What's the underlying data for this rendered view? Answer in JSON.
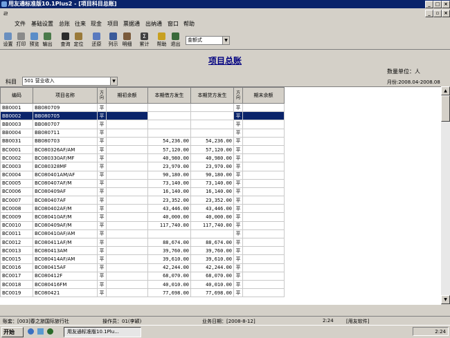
{
  "window": {
    "title": "用友通标准版10.1Plus2 - [项目科目总账]"
  },
  "menu": [
    "文件",
    "基础设置",
    "总账",
    "往来",
    "现金",
    "项目",
    "票据通",
    "出纳通",
    "窗口",
    "帮助"
  ],
  "toolbar": {
    "buttons": [
      {
        "label": "设置",
        "icon": "settings-icon",
        "color": "#6a8fbf"
      },
      {
        "label": "打印",
        "icon": "print-icon",
        "color": "#8a8a8a"
      },
      {
        "label": "预览",
        "icon": "preview-icon",
        "color": "#5b8dc8"
      },
      {
        "label": "输出",
        "icon": "export-icon",
        "color": "#4a7a4a"
      },
      {
        "label": "查询",
        "icon": "query-icon",
        "color": "#2b2b2b"
      },
      {
        "label": "定位",
        "icon": "locate-icon",
        "color": "#9a7a3a"
      },
      {
        "label": "还原",
        "icon": "restore-icon",
        "color": "#5a7abf"
      },
      {
        "label": "列示",
        "icon": "list-icon",
        "color": "#3a5a9a"
      },
      {
        "label": "明细",
        "icon": "detail-icon",
        "color": "#7a5a3a"
      },
      {
        "label": "累计",
        "icon": "sigma-icon",
        "color": "#404040"
      },
      {
        "label": "帮助",
        "icon": "help-icon",
        "color": "#c8a020"
      },
      {
        "label": "退出",
        "icon": "exit-icon",
        "color": "#3a6a3a"
      }
    ],
    "format_select": "金额式"
  },
  "report": {
    "title": "项目总账",
    "unit": "数量单位：人",
    "subject_label": "科目",
    "subject_value": "501 营业收入",
    "period": "月份:2008.04-2008.08"
  },
  "table": {
    "headers": [
      "编码",
      "项目名称",
      "方向",
      "期初余额",
      "本期借方发生",
      "本期贷方发生",
      "方向",
      "期末余额"
    ],
    "rows": [
      [
        "BB0001",
        "BB080709",
        "平",
        "",
        "",
        "",
        "平",
        ""
      ],
      [
        "BB0002",
        "BB080705",
        "平",
        "",
        "",
        "",
        "平",
        ""
      ],
      [
        "BB0003",
        "BB080707",
        "平",
        "",
        "",
        "",
        "平",
        ""
      ],
      [
        "BB0004",
        "BB080711",
        "平",
        "",
        "",
        "",
        "平",
        ""
      ],
      [
        "BB0031",
        "BB080703",
        "平",
        "",
        "54,236.00",
        "54,236.00",
        "平",
        ""
      ],
      [
        "BC0001",
        "BC080326AF/AM",
        "平",
        "",
        "57,120.00",
        "57,120.00",
        "平",
        ""
      ],
      [
        "BC0002",
        "BC080330AF/MF",
        "平",
        "",
        "40,980.00",
        "40,980.00",
        "平",
        ""
      ],
      [
        "BC0003",
        "BC080328MF",
        "平",
        "",
        "23,970.00",
        "23,970.00",
        "平",
        ""
      ],
      [
        "BC0004",
        "BC080401AM/AF",
        "平",
        "",
        "90,180.00",
        "90,180.00",
        "平",
        ""
      ],
      [
        "BC0005",
        "BC080407AF/M",
        "平",
        "",
        "73,140.00",
        "73,140.00",
        "平",
        ""
      ],
      [
        "BC0006",
        "BC080409AF",
        "平",
        "",
        "16,140.00",
        "16,140.00",
        "平",
        ""
      ],
      [
        "BC0007",
        "BC080407AF",
        "平",
        "",
        "23,352.00",
        "23,352.00",
        "平",
        ""
      ],
      [
        "BC0008",
        "BC080402AF/M",
        "平",
        "",
        "43,446.00",
        "43,446.00",
        "平",
        ""
      ],
      [
        "BC0009",
        "BC080410AF/M",
        "平",
        "",
        "40,000.00",
        "40,000.00",
        "平",
        ""
      ],
      [
        "BC0010",
        "BC080409AF/M",
        "平",
        "",
        "117,740.00",
        "117,740.00",
        "平",
        ""
      ],
      [
        "BC0011",
        "BC080410AF/AM",
        "平",
        "",
        "",
        "",
        "平",
        ""
      ],
      [
        "BC0012",
        "BC080411AF/M",
        "平",
        "",
        "88,674.00",
        "88,674.00",
        "平",
        ""
      ],
      [
        "BC0013",
        "BC080413AM",
        "平",
        "",
        "39,760.00",
        "39,760.00",
        "平",
        ""
      ],
      [
        "BC0015",
        "BC080414AF/AM",
        "平",
        "",
        "39,610.00",
        "39,610.00",
        "平",
        ""
      ],
      [
        "BC0016",
        "BC080415AF",
        "平",
        "",
        "42,244.00",
        "42,244.00",
        "平",
        ""
      ],
      [
        "BC0017",
        "BC080412F",
        "平",
        "",
        "68,070.00",
        "68,070.00",
        "平",
        ""
      ],
      [
        "BC0018",
        "BC080416FM",
        "平",
        "",
        "40,010.00",
        "40,010.00",
        "平",
        ""
      ],
      [
        "BC0019",
        "BC080421",
        "平",
        "",
        "77,698.00",
        "77,698.00",
        "平",
        ""
      ]
    ],
    "selected_row_index": 1
  },
  "status": {
    "account": "账套：[003]春之旅国际旅行社",
    "operator": "操作员：01(李颖)",
    "biz_date": "业务日期：[2008-8-12]",
    "time": "2:24",
    "vendor": "[用友软件]"
  },
  "taskbar": {
    "start": "开始",
    "task": "用友通标准版10.1Plu...",
    "clock": "2:24"
  }
}
